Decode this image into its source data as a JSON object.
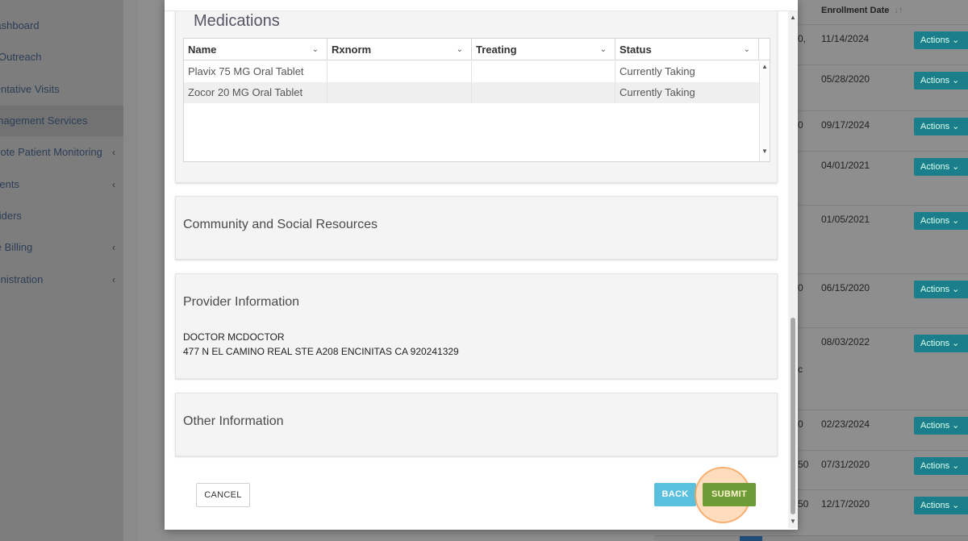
{
  "sidebar": {
    "items": [
      {
        "label": "Dashboard",
        "chevron": false
      },
      {
        "label": "Annual Visit Outreach",
        "chevron": false
      },
      {
        "label": "Preventative Visits",
        "chevron": false
      },
      {
        "label": "Chronic Care Management Services",
        "chevron": false,
        "active": true
      },
      {
        "label": "Remote Patient Monitoring",
        "chevron": true
      },
      {
        "label": "Patients",
        "chevron": true
      },
      {
        "label": "Providers",
        "chevron": false
      },
      {
        "label": "Practice Billing",
        "chevron": true
      },
      {
        "label": "Administration",
        "chevron": true
      }
    ],
    "chevron_glyph": "‹"
  },
  "background_table": {
    "header": "Enrollment Date",
    "sort_icon": "↓↑",
    "actions_label": "Actions",
    "rows": [
      {
        "fragment": "0,",
        "date": "11/14/2024"
      },
      {
        "fragment": "",
        "date": "05/28/2020"
      },
      {
        "fragment": "0",
        "date": "09/17/2024"
      },
      {
        "fragment": "",
        "date": "04/01/2021"
      },
      {
        "fragment": "",
        "date": "01/05/2021"
      },
      {
        "fragment": "0",
        "date": "06/15/2020"
      },
      {
        "fragment": "c",
        "date": "08/03/2022"
      },
      {
        "fragment": "0",
        "date": "02/23/2024"
      },
      {
        "fragment": "50",
        "date": "07/31/2020"
      },
      {
        "fragment": "50",
        "date": "12/17/2020"
      }
    ]
  },
  "modal": {
    "medications": {
      "title": "Medications",
      "columns": [
        "Name",
        "Rxnorm",
        "Treating",
        "Status"
      ],
      "rows": [
        {
          "name": "Plavix 75 MG Oral Tablet",
          "rxnorm": "",
          "treating": "",
          "status": "Currently Taking"
        },
        {
          "name": "Zocor 20 MG Oral Tablet",
          "rxnorm": "",
          "treating": "",
          "status": "Currently Taking"
        }
      ]
    },
    "community": {
      "title": "Community and Social Resources"
    },
    "provider": {
      "title": "Provider Information",
      "name": "DOCTOR MCDOCTOR",
      "address": "477 N EL CAMINO REAL STE A208 ENCINITAS CA 920241329"
    },
    "other": {
      "title": "Other Information"
    },
    "buttons": {
      "cancel": "CANCEL",
      "back": "BACK",
      "submit": "SUBMIT"
    }
  },
  "colors": {
    "back_button": "#5bc0de",
    "submit_button": "#6d9b35",
    "actions_button": "#1a7f8a",
    "highlight": "#f5a05a"
  }
}
